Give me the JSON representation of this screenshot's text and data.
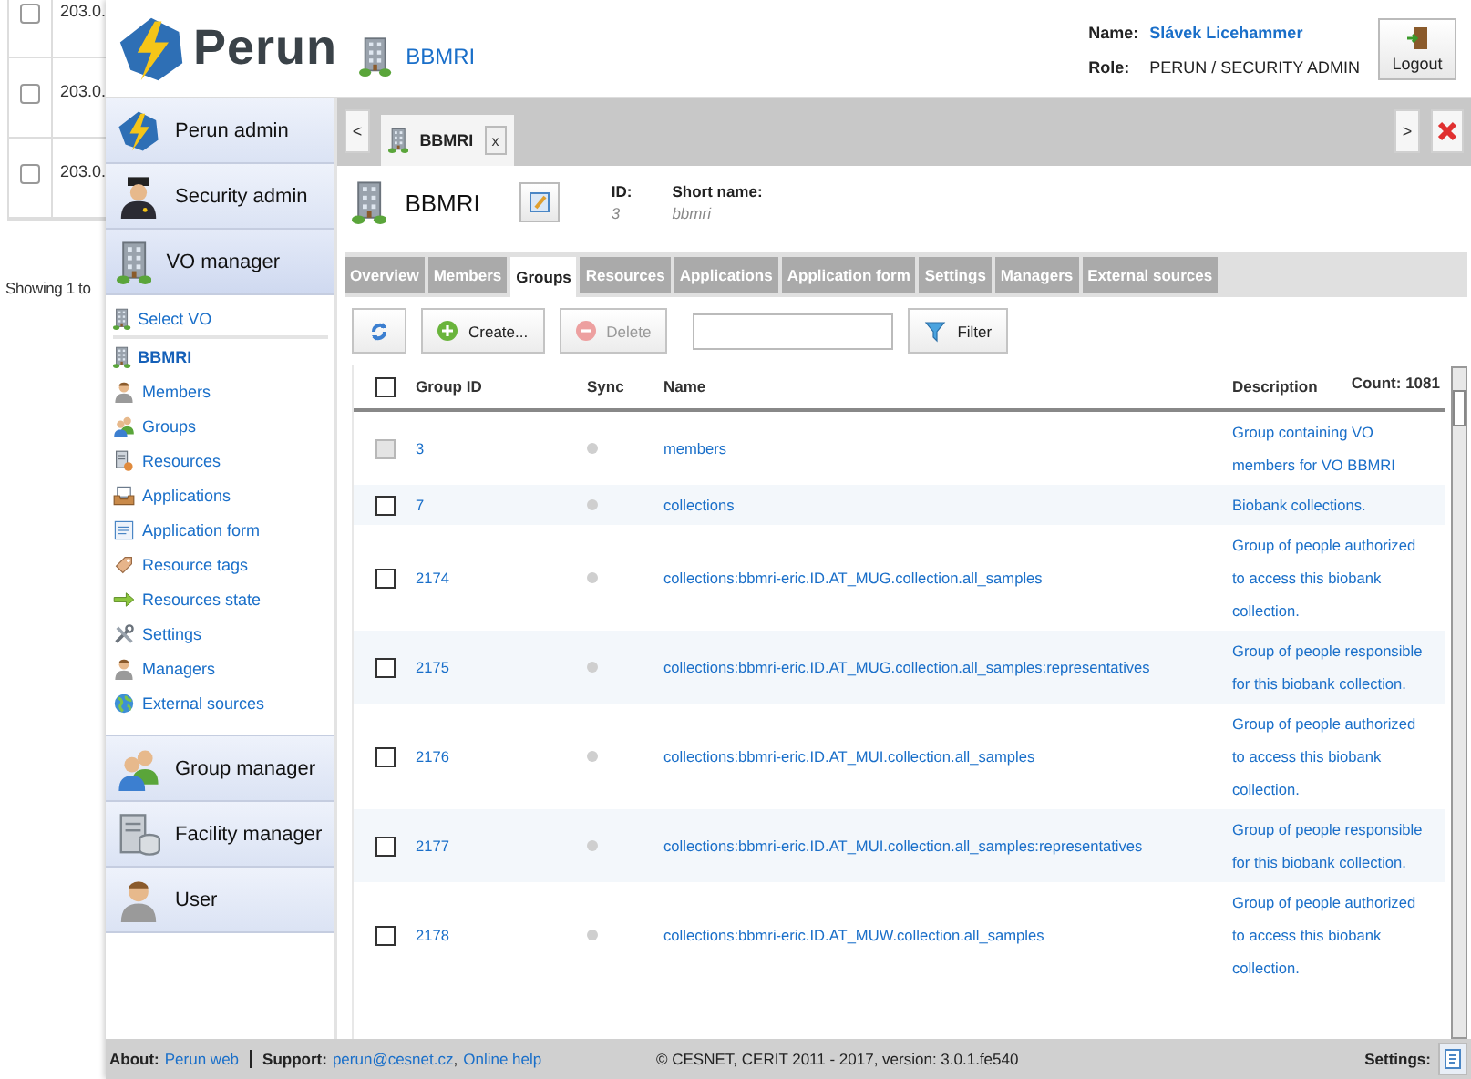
{
  "background_window": {
    "rows": [
      {
        "checked": false,
        "cell": "203.0."
      },
      {
        "checked": false,
        "cell": "203.0."
      },
      {
        "checked": false,
        "cell": "203.0."
      }
    ],
    "footer": "Showing 1 to"
  },
  "header": {
    "logo": "Perun",
    "vo": "BBMRI",
    "name_label": "Name:",
    "name": "Slávek Licehammer",
    "role_label": "Role:",
    "role": "PERUN / SECURITY ADMIN",
    "logout": "Logout"
  },
  "sidebar": {
    "sections": [
      {
        "label": "Perun admin",
        "expanded": false
      },
      {
        "label": "Security admin",
        "expanded": false
      },
      {
        "label": "VO manager",
        "expanded": true,
        "items": [
          {
            "label": "Select VO",
            "selected": false
          },
          {
            "label": "BBMRI",
            "selected": true
          },
          {
            "label": "Members",
            "selected": false
          },
          {
            "label": "Groups",
            "selected": false
          },
          {
            "label": "Resources",
            "selected": false
          },
          {
            "label": "Applications",
            "selected": false
          },
          {
            "label": "Application form",
            "selected": false
          },
          {
            "label": "Resource tags",
            "selected": false
          },
          {
            "label": "Resources state",
            "selected": false
          },
          {
            "label": "Settings",
            "selected": false
          },
          {
            "label": "Managers",
            "selected": false
          },
          {
            "label": "External sources",
            "selected": false
          }
        ]
      },
      {
        "label": "Group manager",
        "expanded": false
      },
      {
        "label": "Facility manager",
        "expanded": false
      },
      {
        "label": "User",
        "expanded": false
      }
    ]
  },
  "main": {
    "tab_bar": {
      "prev": "<",
      "next": ">",
      "tabs": [
        {
          "label": "BBMRI",
          "close": "x",
          "selected": true
        }
      ]
    },
    "vo_header": {
      "title": "BBMRI",
      "id_label": "ID:",
      "id": "3",
      "short_name_label": "Short name:",
      "short_name": "bbmri"
    },
    "tabs": [
      {
        "label": "Overview",
        "selected": false
      },
      {
        "label": "Members",
        "selected": false
      },
      {
        "label": "Groups",
        "selected": true
      },
      {
        "label": "Resources",
        "selected": false
      },
      {
        "label": "Applications",
        "selected": false
      },
      {
        "label": "Application form",
        "selected": false
      },
      {
        "label": "Settings",
        "selected": false
      },
      {
        "label": "Managers",
        "selected": false
      },
      {
        "label": "External sources",
        "selected": false
      }
    ],
    "toolbar": {
      "create": "Create...",
      "delete": "Delete",
      "delete_disabled": true,
      "filter": "Filter"
    },
    "table": {
      "select_all": false,
      "columns": [
        "Group ID",
        "Sync",
        "Name",
        "Description"
      ],
      "count": "Count: 1081",
      "rows": [
        {
          "id": "3",
          "name": "members",
          "description": "Group containing VO members for VO BBMRI",
          "checked": false,
          "disabled": true
        },
        {
          "id": "7",
          "name": "collections",
          "description": "Biobank collections.",
          "checked": false,
          "disabled": false
        },
        {
          "id": "2174",
          "name": "collections:bbmri-eric.ID.AT_MUG.collection.all_samples",
          "description": "Group of people authorized to access this biobank collection.",
          "checked": false,
          "disabled": false
        },
        {
          "id": "2175",
          "name": "collections:bbmri-eric.ID.AT_MUG.collection.all_samples:representatives",
          "description": "Group of people responsible for this biobank collection.",
          "checked": false,
          "disabled": false
        },
        {
          "id": "2176",
          "name": "collections:bbmri-eric.ID.AT_MUI.collection.all_samples",
          "description": "Group of people authorized to access this biobank collection.",
          "checked": false,
          "disabled": false
        },
        {
          "id": "2177",
          "name": "collections:bbmri-eric.ID.AT_MUI.collection.all_samples:representatives",
          "description": "Group of people responsible for this biobank collection.",
          "checked": false,
          "disabled": false
        },
        {
          "id": "2178",
          "name": "collections:bbmri-eric.ID.AT_MUW.collection.all_samples",
          "description": "Group of people authorized to access this biobank collection.",
          "checked": false,
          "disabled": false
        }
      ]
    }
  },
  "footer": {
    "about_label": "About:",
    "about_link": "Perun web",
    "support_label": "Support:",
    "email": "perun@cesnet.cz",
    "comma": ",",
    "help": "Online help",
    "copyright": "© CESNET, CERIT 2011 - 2017, version: 3.0.1.fe540",
    "settings_label": "Settings:"
  }
}
